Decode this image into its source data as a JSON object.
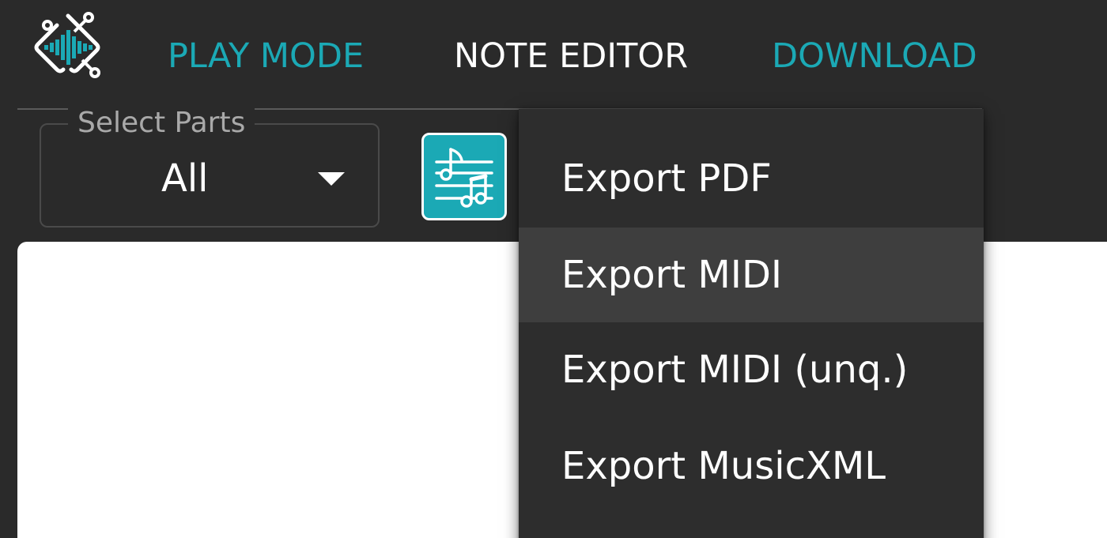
{
  "nav": {
    "logo_icon": "waveform-circuit-logo",
    "tabs": [
      {
        "label": "PLAY MODE",
        "color": "#1ba9b5"
      },
      {
        "label": "NOTE EDITOR",
        "color": "#ffffff"
      },
      {
        "label": "DOWNLOAD",
        "color": "#1ba9b5"
      }
    ]
  },
  "parts_select": {
    "legend": "Select Parts",
    "value": "All",
    "icon": "caret-down-icon"
  },
  "score_button": {
    "icon": "music-notes-sliders-icon",
    "color": "#1ba9b5"
  },
  "download_menu": {
    "items": [
      {
        "label": "Export PDF"
      },
      {
        "label": "Export MIDI",
        "highlighted": true
      },
      {
        "label": "Export MIDI (unq.)"
      },
      {
        "label": "Export MusicXML"
      }
    ]
  },
  "colors": {
    "accent": "#1ba9b5",
    "background": "#2a2a2a",
    "menu_background": "#2d2d2d",
    "menu_hover": "#3e3e3e"
  }
}
